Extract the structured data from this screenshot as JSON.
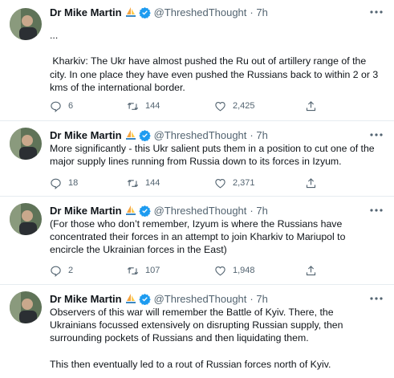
{
  "tweets": [
    {
      "author": "Dr Mike Martin",
      "handle": "@ThreshedThought",
      "time": "· 7h",
      "text": "...\n\n Kharkiv: The Ukr have almost pushed the Ru out of artillery range of the city. In one place they have even pushed the Russians back to within 2 or 3 kms of the international border.",
      "replies": "6",
      "retweets": "144",
      "likes": "2,425"
    },
    {
      "author": "Dr Mike Martin",
      "handle": "@ThreshedThought",
      "time": "· 7h",
      "text": "More significantly - this Ukr salient puts them in a position to cut one of the major supply lines running from Russia down to its forces in Izyum.",
      "replies": "18",
      "retweets": "144",
      "likes": "2,371"
    },
    {
      "author": "Dr Mike Martin",
      "handle": "@ThreshedThought",
      "time": "· 7h",
      "text": "(For those who don’t remember, Izyum is where the Russians have concentrated their forces in an attempt to join Kharkiv to Mariupol to encircle the Ukrainian forces in the East)",
      "replies": "2",
      "retweets": "107",
      "likes": "1,948"
    },
    {
      "author": "Dr Mike Martin",
      "handle": "@ThreshedThought",
      "time": "· 7h",
      "text": "Observers of this war will remember the Battle of Kyiv. There, the Ukrainians focussed extensively on disrupting Russian supply, then surrounding pockets of Russians and then liquidating them.\n\nThis then eventually led to a rout of Russian forces north of Kyiv."
    }
  ],
  "colors": {
    "verified": "#1d9bf0",
    "muted": "#536471",
    "divider": "#e6ecf0"
  },
  "icons": [
    "more-icon",
    "reply-icon",
    "retweet-icon",
    "like-icon",
    "share-icon",
    "verified-badge-icon",
    "sailboat-flag-icon"
  ]
}
